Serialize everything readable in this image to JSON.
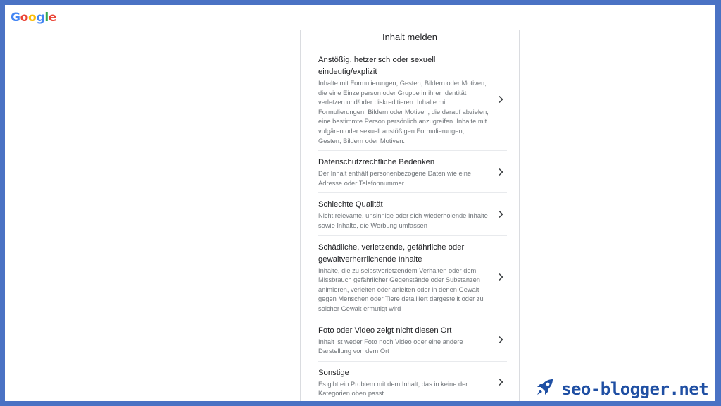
{
  "logo": {
    "letters": [
      {
        "ch": "G",
        "color": "#4285f4"
      },
      {
        "ch": "o",
        "color": "#ea4335"
      },
      {
        "ch": "o",
        "color": "#fbbc05"
      },
      {
        "ch": "g",
        "color": "#4285f4"
      },
      {
        "ch": "l",
        "color": "#34a853"
      },
      {
        "ch": "e",
        "color": "#ea4335"
      }
    ]
  },
  "panel": {
    "title": "Inhalt melden",
    "items": [
      {
        "title": "Anstößig, hetzerisch oder sexuell eindeutig/explizit",
        "desc": "Inhalte mit Formulierungen, Gesten, Bildern oder Motiven, die eine Einzelperson oder Gruppe in ihrer Identität verletzen und/oder diskreditieren. Inhalte mit Formulierungen, Bildern oder Motiven, die darauf abzielen, eine bestimmte Person persönlich anzugreifen. Inhalte mit vulgären oder sexuell anstößigen Formulierungen, Gesten, Bildern oder Motiven."
      },
      {
        "title": "Datenschutzrechtliche Bedenken",
        "desc": "Der Inhalt enthält personenbezogene Daten wie eine Adresse oder Telefonnummer"
      },
      {
        "title": "Schlechte Qualität",
        "desc": "Nicht relevante, unsinnige oder sich wiederholende Inhalte sowie Inhalte, die Werbung umfassen"
      },
      {
        "title": "Schädliche, verletzende, gefährliche oder gewaltverherrlichende Inhalte",
        "desc": "Inhalte, die zu selbstverletzendem Verhalten oder dem Missbrauch gefährlicher Gegenstände oder Substanzen animieren, verleiten oder anleiten oder in denen Gewalt gegen Menschen oder Tiere detailliert dargestellt oder zu solcher Gewalt ermutigt wird"
      },
      {
        "title": "Foto oder Video zeigt nicht diesen Ort",
        "desc": "Inhalt ist weder Foto noch Video oder eine andere Darstellung von dem Ort"
      },
      {
        "title": "Sonstige",
        "desc": "Es gibt ein Problem mit dem Inhalt, das in keine der Kategorien oben passt"
      }
    ]
  },
  "brand": {
    "text": "seo-blogger.net",
    "icon": "rocket-icon",
    "color": "#1f4fa3"
  },
  "colors": {
    "border": "#4a72c4"
  }
}
